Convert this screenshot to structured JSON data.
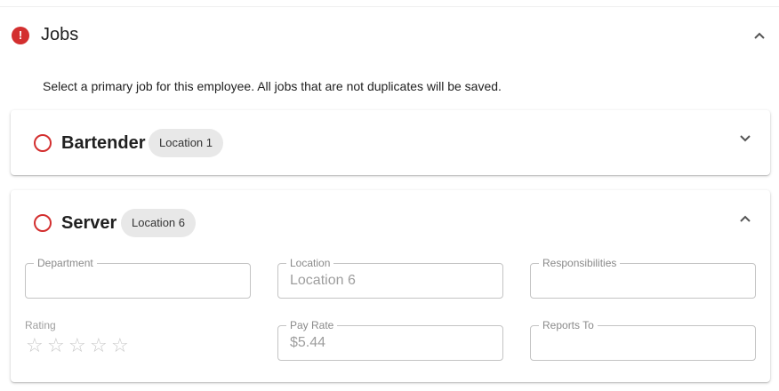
{
  "section": {
    "title": "Jobs",
    "error_icon": "!",
    "instructions": "Select a primary job for this employee. All jobs that are not duplicates will be saved."
  },
  "jobs": [
    {
      "title": "Bartender",
      "location_chip": "Location 1",
      "expanded": false
    },
    {
      "title": "Server",
      "location_chip": "Location 6",
      "expanded": true,
      "fields": {
        "department": {
          "label": "Department",
          "value": ""
        },
        "location": {
          "label": "Location",
          "value": "Location 6"
        },
        "responsibilities": {
          "label": "Responsibilities",
          "value": ""
        },
        "pay_rate": {
          "label": "Pay Rate",
          "value": "$5.44"
        },
        "reports_to": {
          "label": "Reports To",
          "value": ""
        }
      },
      "rating": {
        "label": "Rating",
        "value": 0,
        "max": 5,
        "star_glyph": "☆"
      }
    }
  ],
  "colors": {
    "error": "#d32f2f",
    "chip_bg": "#e8e8e8",
    "field_border": "#c4c4c4"
  },
  "icons": [
    "error-icon",
    "chevron-up-icon",
    "chevron-down-icon",
    "radio-unchecked-icon",
    "star-outline-icon"
  ]
}
